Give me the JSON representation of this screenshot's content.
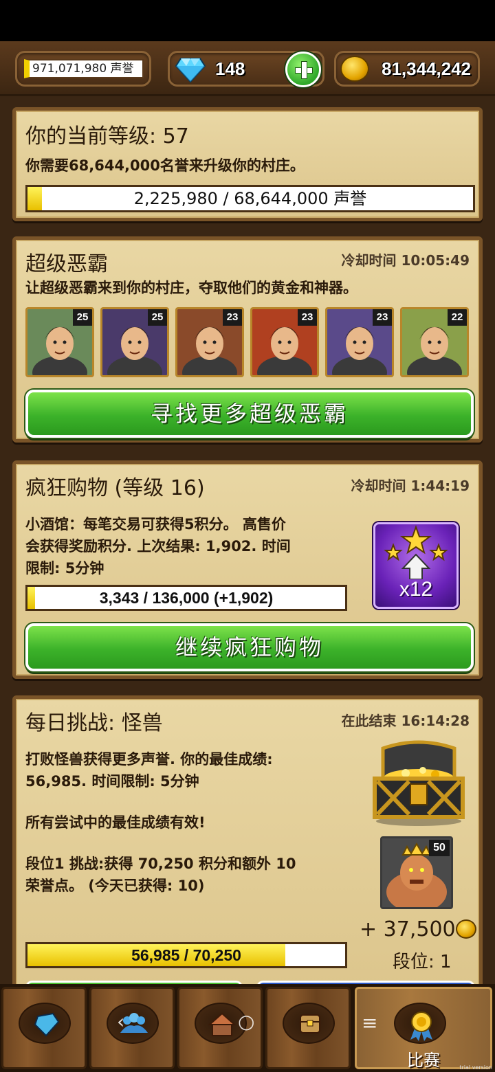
{
  "header": {
    "fame_value": "971,071,980 声誉",
    "gems": "148",
    "gold": "81,344,242"
  },
  "level_panel": {
    "title": "你的当前等级: 57",
    "subtitle": "你需要68,644,000名誉来升级你的村庄。",
    "progress_label": "2,225,980 / 68,644,000 声誉",
    "progress_fraction": 0.0324
  },
  "villains_panel": {
    "title": "超级恶霸",
    "cooldown": "冷却时间 10:05:49",
    "description": "让超级恶霸来到你的村庄，夺取他们的黄金和神器。",
    "heroes": [
      {
        "level": "25",
        "color": "#6a8a5a"
      },
      {
        "level": "25",
        "color": "#4a3a6a"
      },
      {
        "level": "23",
        "color": "#8a4a2a"
      },
      {
        "level": "23",
        "color": "#b04020"
      },
      {
        "level": "23",
        "color": "#5a4a8a"
      },
      {
        "level": "22",
        "color": "#8aa04a"
      }
    ],
    "button_label": "寻找更多超级恶霸"
  },
  "shopping_panel": {
    "title": "疯狂购物 (等级 16)",
    "cooldown": "冷却时间 1:44:19",
    "description_lines": [
      "小酒馆：每笔交易可获得5积分。 高售价",
      "会获得奖励积分. 上次结果: 1,902. 时间",
      "限制: 5分钟"
    ],
    "progress_label": "3,343 / 136,000 (+1,902)",
    "progress_fraction": 0.0246,
    "badge": "x12",
    "button_label": "继续疯狂购物"
  },
  "challenge_panel": {
    "title": "每日挑战: 怪兽",
    "ends": "在此结束 16:14:28",
    "desc1_lines": [
      "打败怪兽获得更多声誉. 你的最佳成绩:",
      "56,985. 时间限制: 5分钟"
    ],
    "desc2": "所有尝试中的最佳成绩有效!",
    "desc3_lines": [
      "段位1 挑战:获得 70,250 积分和额外 10",
      "荣誉点。 (今天已获得: 10)"
    ],
    "monster_level": "50",
    "reward": "+ 37,500",
    "rank": "段位: 1",
    "progress_label": "56,985 / 70,250",
    "progress_fraction": 0.811
  },
  "bottom_nav": {
    "active_label": "比赛",
    "watermark": "trial version"
  }
}
